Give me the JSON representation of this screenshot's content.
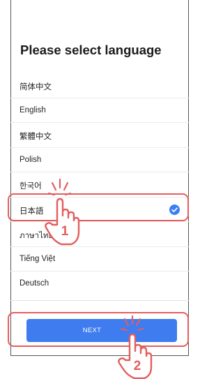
{
  "screen": {
    "title": "Please select language"
  },
  "languages": [
    {
      "label": "简体中文",
      "selected": false
    },
    {
      "label": "English",
      "selected": false
    },
    {
      "label": "繁體中文",
      "selected": false
    },
    {
      "label": "Polish",
      "selected": false
    },
    {
      "label": "한국어",
      "selected": false
    },
    {
      "label": "日本語",
      "selected": true
    },
    {
      "label": "ภาษาไทย",
      "selected": false
    },
    {
      "label": "Tiếng Việt",
      "selected": false
    },
    {
      "label": "Deutsch",
      "selected": false
    }
  ],
  "next_button": {
    "label": "NEXT"
  },
  "callouts": [
    {
      "number": "1"
    },
    {
      "number": "2"
    }
  ],
  "colors": {
    "accent_blue": "#3e7cf0",
    "highlight_red": "#e35e5e"
  },
  "icons": {
    "selected_marker": "check-circle-icon",
    "tap_gesture": "tap-hand-icon"
  }
}
